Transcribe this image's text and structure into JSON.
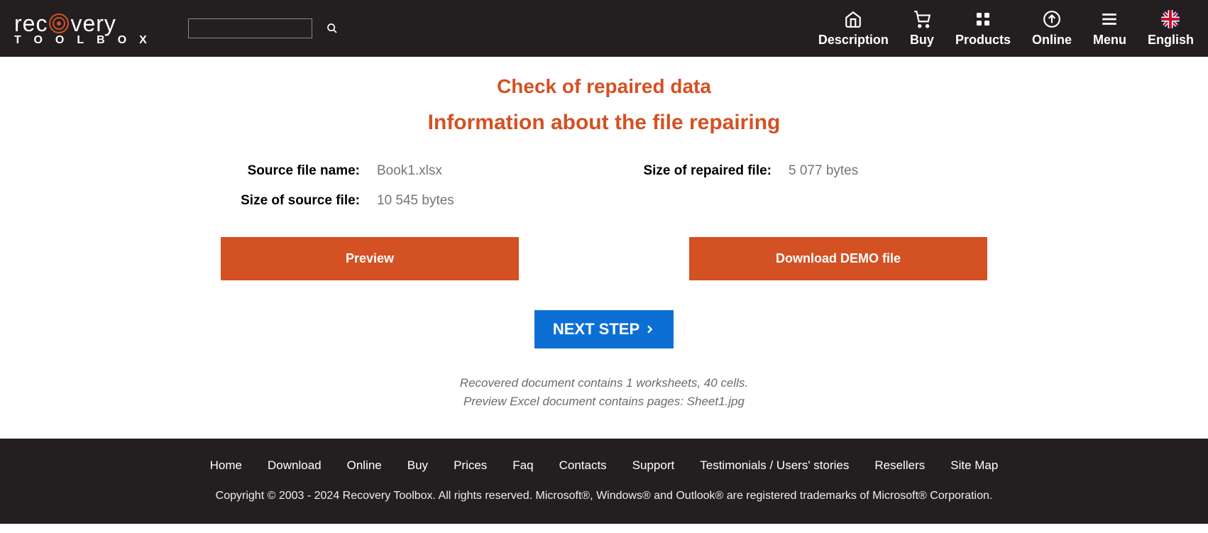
{
  "nav": {
    "description": "Description",
    "buy": "Buy",
    "products": "Products",
    "online": "Online",
    "menu": "Menu",
    "english": "English"
  },
  "search": {
    "placeholder": ""
  },
  "headings": {
    "h1": "Check of repaired data",
    "h2": "Information about the file repairing"
  },
  "info": {
    "source_name_label": "Source file name:",
    "source_name_value": "Book1.xlsx",
    "source_size_label": "Size of source file:",
    "source_size_value": "10 545 bytes",
    "repaired_size_label": "Size of repaired file:",
    "repaired_size_value": "5 077 bytes"
  },
  "buttons": {
    "preview": "Preview",
    "download_demo": "Download DEMO file",
    "next_step": "NEXT STEP"
  },
  "notes": {
    "line1": "Recovered document contains 1 worksheets, 40 cells.",
    "line2": "Preview Excel document contains pages: Sheet1.jpg"
  },
  "footer": {
    "links": {
      "home": "Home",
      "download": "Download",
      "online": "Online",
      "buy": "Buy",
      "prices": "Prices",
      "faq": "Faq",
      "contacts": "Contacts",
      "support": "Support",
      "testimonials": "Testimonials / Users' stories",
      "resellers": "Resellers",
      "sitemap": "Site Map"
    },
    "copyright": "Copyright © 2003 -  2024  Recovery Toolbox. All rights reserved. Microsoft®, Windows® and Outlook® are registered trademarks of Microsoft® Corporation."
  }
}
